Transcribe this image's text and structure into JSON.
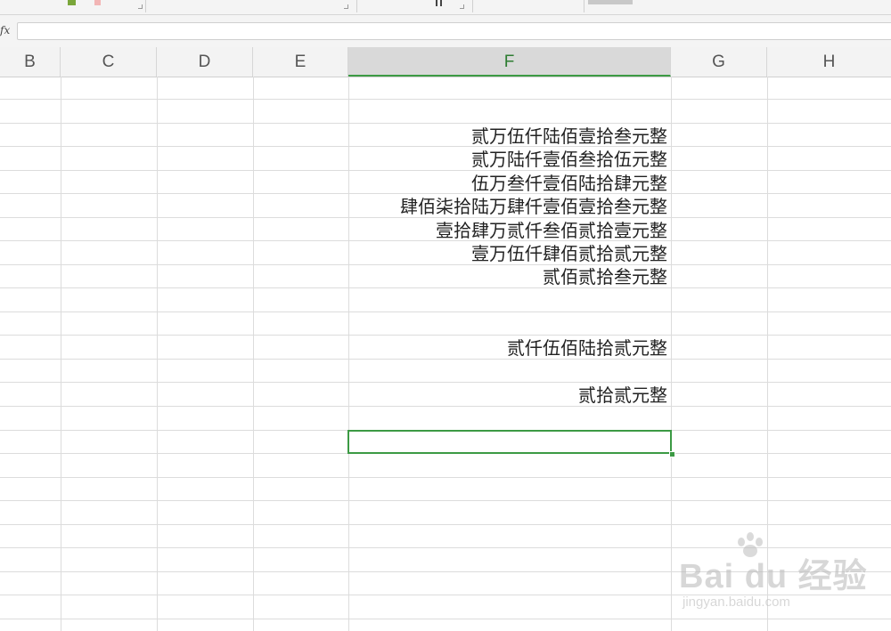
{
  "formula_bar": {
    "fx_label": "fx",
    "value": ""
  },
  "columns": [
    "B",
    "C",
    "D",
    "E",
    "F",
    "G",
    "H"
  ],
  "active_column": "F",
  "column_f_cells": [
    {
      "row": 1,
      "text": ""
    },
    {
      "row": 2,
      "text": ""
    },
    {
      "row": 3,
      "text": "贰万伍仟陆佰壹拾叁元整"
    },
    {
      "row": 4,
      "text": "贰万陆仟壹佰叁拾伍元整"
    },
    {
      "row": 5,
      "text": "伍万叁仟壹佰陆拾肆元整"
    },
    {
      "row": 6,
      "text": "肆佰柒拾陆万肆仟壹佰壹拾叁元整"
    },
    {
      "row": 7,
      "text": "壹拾肆万贰仟叁佰贰拾壹元整"
    },
    {
      "row": 8,
      "text": "壹万伍仟肆佰贰拾贰元整"
    },
    {
      "row": 9,
      "text": "贰佰贰拾叁元整"
    },
    {
      "row": 10,
      "text": ""
    },
    {
      "row": 11,
      "text": ""
    },
    {
      "row": 12,
      "text": "贰仟伍佰陆拾贰元整"
    },
    {
      "row": 13,
      "text": ""
    },
    {
      "row": 14,
      "text": "贰拾贰元整"
    },
    {
      "row": 15,
      "text": ""
    }
  ],
  "selected_cell": "F16",
  "watermark": {
    "logo": "Bai du 经验",
    "url": "jingyan.baidu.com"
  },
  "colors": {
    "accent_green": "#3c9a44",
    "grid_line": "#dcdcdc",
    "header_bg": "#f3f3f3"
  }
}
